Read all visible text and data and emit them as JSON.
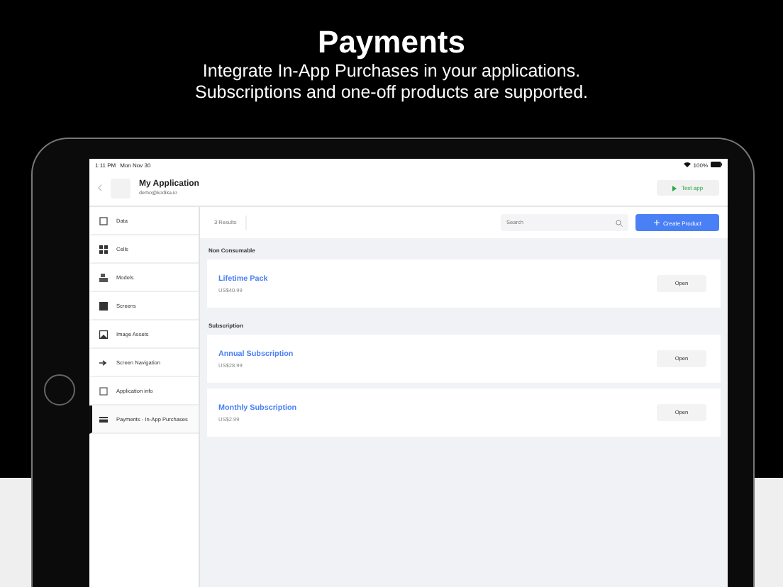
{
  "header": {
    "title": "Payments",
    "subtitle_lines": [
      "Integrate In-App Purchases in your applications.",
      "Subscriptions and one-off products are supported."
    ]
  },
  "status_bar": {
    "time": "1:11 PM",
    "date": "Mon Nov 30",
    "battery": "100%"
  },
  "app": {
    "name": "My Application",
    "email": "demo@kodika.io",
    "test_button": "Test app"
  },
  "sidebar": {
    "items": [
      {
        "label": "Data",
        "selected": false
      },
      {
        "label": "Cells",
        "selected": false
      },
      {
        "label": "Models",
        "selected": false
      },
      {
        "label": "Screens",
        "selected": false
      },
      {
        "label": "Image Assets",
        "selected": false
      },
      {
        "label": "Screen Navigation",
        "selected": false
      },
      {
        "label": "Application info",
        "selected": false
      },
      {
        "label": "Payments - In-App Purchases",
        "selected": true
      }
    ]
  },
  "toolbar": {
    "results": "3 Results",
    "search": {
      "placeholder": "Search"
    },
    "create_button": "Create Product"
  },
  "sections": [
    {
      "title": "Non Consumable",
      "products": [
        {
          "name": "Lifetime Pack",
          "price": "US$40.99",
          "button": "Open"
        }
      ]
    },
    {
      "title": "Subscription",
      "products": [
        {
          "name": "Annual Subscription",
          "price": "US$28.99",
          "button": "Open"
        },
        {
          "name": "Monthly Subscription",
          "price": "US$2.99",
          "button": "Open"
        }
      ]
    }
  ]
}
